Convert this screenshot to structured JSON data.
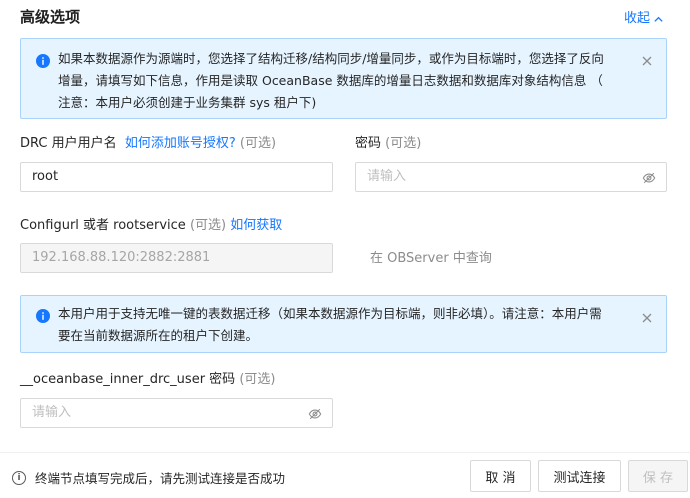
{
  "section": {
    "title": "高级选项",
    "collapse_label": "收起"
  },
  "alert_top": {
    "lines": [
      "如果本数据源作为源端时，您选择了结构迁移/结构同步/增量同步，或作为目标端时，您选择了反向",
      "增量，请填写如下信息，作用是读取 OceanBase 数据库的增量日志数据和数据库对象结构信息 （",
      "注意：本用户必须创建于业务集群 sys 租户下)"
    ]
  },
  "drc_user": {
    "label": "DRC 用户用户名",
    "help_link": "如何添加账号授权?",
    "optional": "(可选)",
    "value": "root"
  },
  "password": {
    "label": "密码",
    "optional": "(可选)",
    "placeholder": "请输入"
  },
  "configurl": {
    "label": "Configurl 或者 rootservice",
    "optional": "(可选)",
    "help_link": "如何获取",
    "value": "192.168.88.120:2882:2881",
    "observer_query": "在 OBServer 中查询"
  },
  "alert_bottom": {
    "lines": [
      "本用户用于支持无唯一键的表数据迁移（如果本数据源作为目标端，则非必填）。请注意：本用户需",
      "要在当前数据源所在的租户下创建。"
    ]
  },
  "inner_drc_password": {
    "label": "__oceanbase_inner_drc_user 密码",
    "optional": "(可选)",
    "placeholder": "请输入"
  },
  "footer": {
    "note": "终端节点填写完成后，请先测试连接是否成功",
    "cancel_label": "取 消",
    "test_label": "测试连接",
    "save_label": "保 存"
  },
  "colors": {
    "link": "#1677ff",
    "alert_bg": "#e6f4ff",
    "alert_border": "#a9d3fb"
  }
}
